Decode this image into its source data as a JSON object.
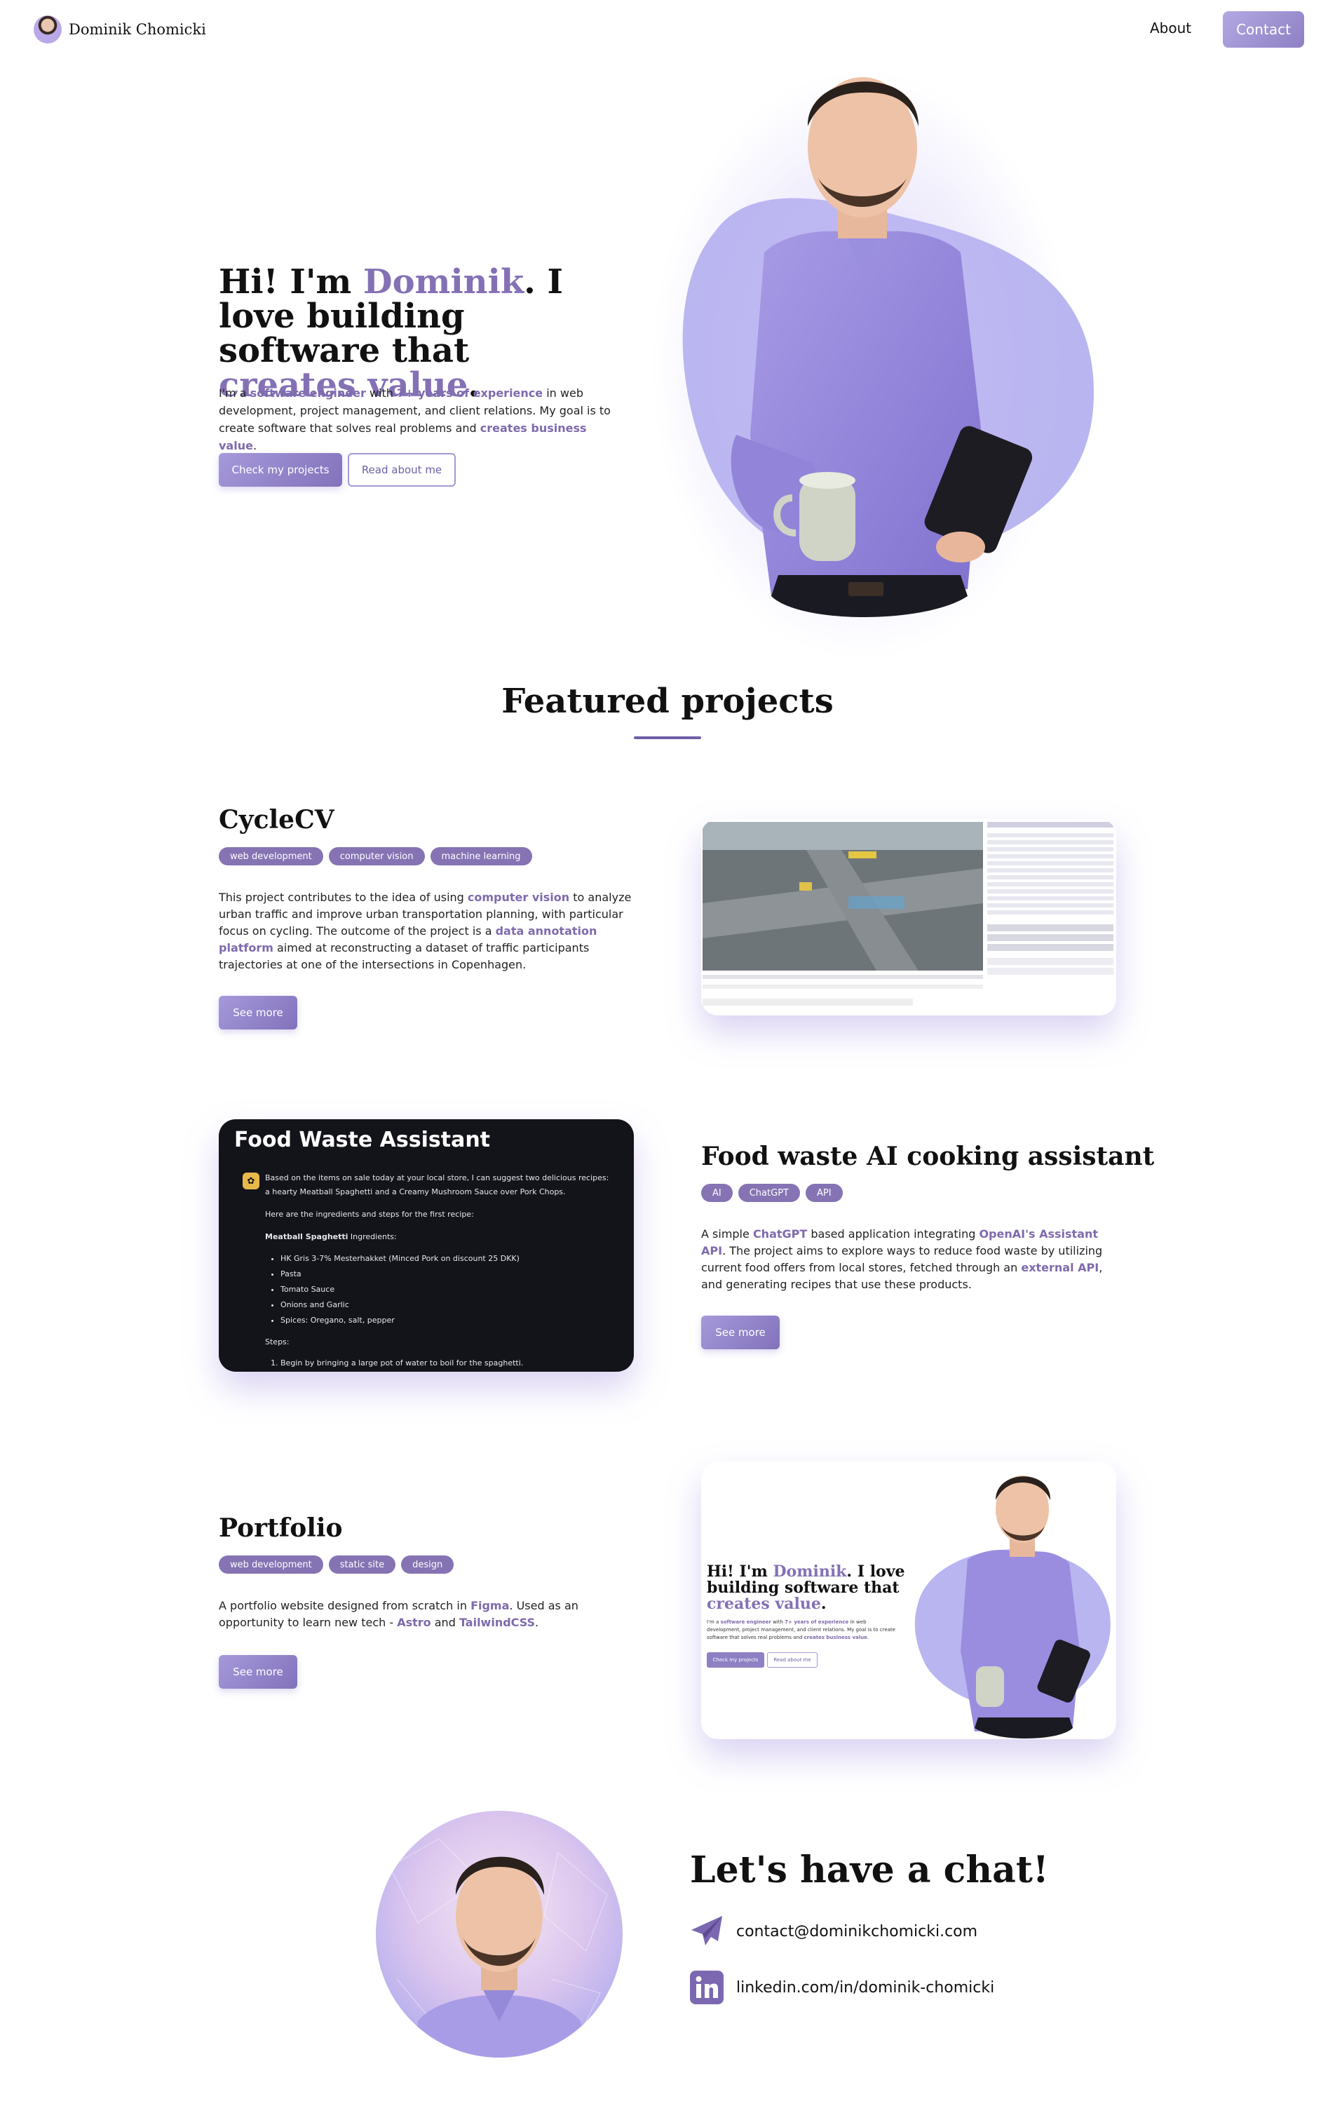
{
  "nav": {
    "brand": "Dominik Chomicki",
    "about": "About",
    "contact": "Contact"
  },
  "hero": {
    "title_a": "Hi! I'm ",
    "title_name": "Dominik",
    "title_b": ". I love building software that ",
    "title_value": "creates value",
    "title_c": ".",
    "p1": "I'm a ",
    "p_role": "software engineer",
    "p2": " with ",
    "p_exp": "7+ years of experience",
    "p3": " in web development, project management, and client relations. My goal is to create software that solves real problems and ",
    "p_value": "creates business value",
    "p4": ".",
    "btn_projects": "Check my projects",
    "btn_about": "Read about me"
  },
  "featured": {
    "title": "Featured projects"
  },
  "projects": [
    {
      "title": "CycleCV",
      "tags": [
        "web development",
        "computer vision",
        "machine learning"
      ],
      "t1": "This project contributes to the idea of using ",
      "t_cv": "computer vision",
      "t2": " to analyze urban traffic and improve urban transportation planning, with particular focus on cycling. The outcome of the project is a ",
      "t_dap": "data annotation platform",
      "t3": " aimed at reconstructing a dataset of traffic participants trajectories at one of the intersections in Copenhagen.",
      "btn": "See more"
    },
    {
      "title": "Food waste AI cooking assistant",
      "tags": [
        "AI",
        "ChatGPT",
        "API"
      ],
      "t1": "A simple ",
      "t_gpt": "ChatGPT",
      "t2": " based application integrating ",
      "t_api": "OpenAI's Assistant API",
      "t3": ". The project aims to explore ways to reduce food waste by utilizing current food offers from local stores, fetched through an ",
      "t_ext": "external API",
      "t4": ", and generating recipes that use these products.",
      "btn": "See more",
      "card": {
        "title": "Food Waste Assistant",
        "intro": "Based on the items on sale today at your local store, I can suggest two delicious recipes: a hearty Meatball Spaghetti and a Creamy Mushroom Sauce over Pork Chops.",
        "line2": "Here are the ingredients and steps for the first recipe:",
        "recipe_name": "Meatball Spaghetti",
        "recipe_suffix": " Ingredients:",
        "ingredients": [
          "HK Gris 3-7% Mesterhakket (Minced Pork on discount 25 DKK)",
          "Pasta",
          "Tomato Sauce",
          "Onions and Garlic",
          "Spices: Oregano, salt, pepper"
        ],
        "steps_label": "Steps:",
        "step1": "Begin by bringing a large pot of water to boil for the spaghetti."
      }
    },
    {
      "title": "Portfolio",
      "tags": [
        "web development",
        "static site",
        "design"
      ],
      "t1": "A portfolio website designed from scratch in ",
      "t_figma": "Figma",
      "t2": ". Used as an opportunity to learn new tech - ",
      "t_astro": "Astro",
      "t3": " and ",
      "t_tw": "TailwindCSS",
      "t4": ".",
      "btn": "See more"
    }
  ],
  "chat": {
    "title": "Let's have a chat!",
    "email": "contact@dominikchomicki.com",
    "linkedin": "linkedin.com/in/dominik-chomicki"
  },
  "colors": {
    "accent": "#8471b5",
    "blob": "#b8b5f0",
    "dark_card": "#13131a"
  }
}
